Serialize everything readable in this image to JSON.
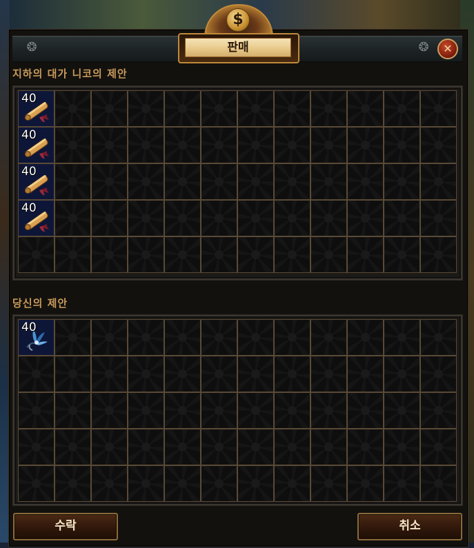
{
  "window": {
    "title": "판매",
    "close_glyph": "✕"
  },
  "npc_offer": {
    "label": "지하의 대가 니코의 제안",
    "items": [
      {
        "row": 0,
        "col": 0,
        "stack": "40",
        "icon": "scroll-icon"
      },
      {
        "row": 1,
        "col": 0,
        "stack": "40",
        "icon": "scroll-icon"
      },
      {
        "row": 2,
        "col": 0,
        "stack": "40",
        "icon": "scroll-icon"
      },
      {
        "row": 3,
        "col": 0,
        "stack": "40",
        "icon": "scroll-icon"
      }
    ],
    "rows": 5,
    "cols": 12
  },
  "your_offer": {
    "label": "당신의 제안",
    "items": [
      {
        "row": 0,
        "col": 0,
        "stack": "40",
        "icon": "blue-flower-icon"
      }
    ],
    "rows": 5,
    "cols": 12
  },
  "buttons": {
    "accept": "수락",
    "cancel": "취소"
  },
  "currency_symbol": "$"
}
